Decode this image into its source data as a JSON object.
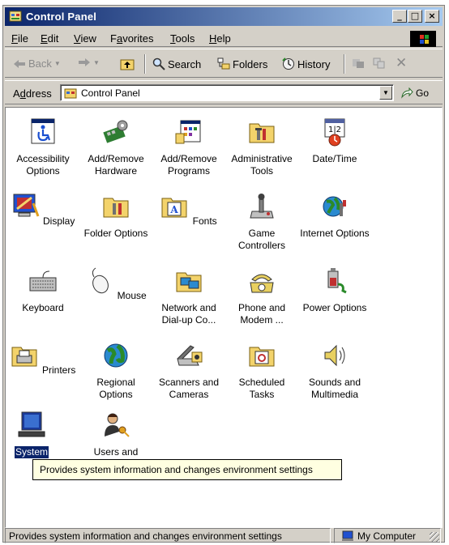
{
  "window": {
    "title": "Control Panel",
    "controls": {
      "minimize": "_",
      "maximize": "□",
      "close": "×"
    }
  },
  "menu": [
    {
      "label": "File",
      "key": "F",
      "rest": "ile"
    },
    {
      "label": "Edit",
      "key": "E",
      "rest": "dit"
    },
    {
      "label": "View",
      "key": "V",
      "rest": "iew"
    },
    {
      "label": "Favorites",
      "key": "a",
      "pre": "F",
      "rest": "vorites"
    },
    {
      "label": "Tools",
      "key": "T",
      "rest": "ools"
    },
    {
      "label": "Help",
      "key": "H",
      "rest": "elp"
    }
  ],
  "toolbar": {
    "back": "Back",
    "search": "Search",
    "folders": "Folders",
    "history": "History"
  },
  "address": {
    "label_pre": "A",
    "label_key": "d",
    "label_rest": "dress",
    "value": "Control Panel",
    "go": "Go"
  },
  "items": [
    {
      "label": "Accessibility Options",
      "icon": "accessibility-icon"
    },
    {
      "label": "Add/Remove Hardware",
      "icon": "add-remove-hardware-icon"
    },
    {
      "label": "Add/Remove Programs",
      "icon": "add-remove-programs-icon"
    },
    {
      "label": "Administrative Tools",
      "icon": "administrative-tools-icon"
    },
    {
      "label": "Date/Time",
      "icon": "date-time-icon"
    },
    {
      "label": "Display",
      "icon": "display-icon"
    },
    {
      "label": "Folder Options",
      "icon": "folder-options-icon"
    },
    {
      "label": "Fonts",
      "icon": "fonts-icon"
    },
    {
      "label": "Game Controllers",
      "icon": "game-controllers-icon"
    },
    {
      "label": "Internet Options",
      "icon": "internet-options-icon"
    },
    {
      "label": "Keyboard",
      "icon": "keyboard-icon"
    },
    {
      "label": "Mouse",
      "icon": "mouse-icon"
    },
    {
      "label": "Network and Dial-up Co...",
      "icon": "network-icon"
    },
    {
      "label": "Phone and Modem ...",
      "icon": "phone-modem-icon"
    },
    {
      "label": "Power Options",
      "icon": "power-options-icon"
    },
    {
      "label": "Printers",
      "icon": "printers-icon"
    },
    {
      "label": "Regional Options",
      "icon": "regional-options-icon"
    },
    {
      "label": "Scanners and Cameras",
      "icon": "scanners-cameras-icon"
    },
    {
      "label": "Scheduled Tasks",
      "icon": "scheduled-tasks-icon"
    },
    {
      "label": "Sounds and Multimedia",
      "icon": "sounds-multimedia-icon"
    },
    {
      "label": "System",
      "icon": "system-icon",
      "selected": true
    },
    {
      "label": "Users and",
      "icon": "users-passwords-icon"
    }
  ],
  "tooltip": "Provides system information and changes environment settings",
  "status": {
    "text": "Provides system information and changes environment settings",
    "zone": "My Computer"
  },
  "colors": {
    "title_start": "#0a246a",
    "title_end": "#a6caf0",
    "face": "#d4d0c8",
    "selection": "#0a246a",
    "tooltip_bg": "#ffffe1"
  }
}
